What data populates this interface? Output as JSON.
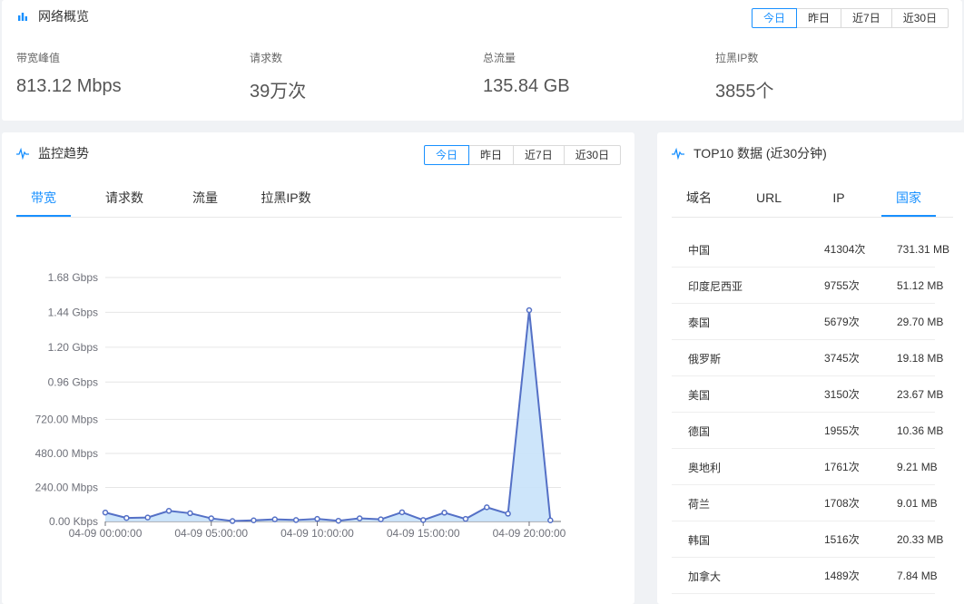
{
  "overview": {
    "title": "网络概览",
    "ranges": [
      "今日",
      "昨日",
      "近7日",
      "近30日"
    ],
    "stats": [
      {
        "label": "带宽峰值",
        "value": "813.12 Mbps"
      },
      {
        "label": "请求数",
        "value": "39万次"
      },
      {
        "label": "总流量",
        "value": "135.84 GB"
      },
      {
        "label": "拉黑IP数",
        "value": "3855个"
      }
    ]
  },
  "trend": {
    "title": "监控趋势",
    "ranges": [
      "今日",
      "昨日",
      "近7日",
      "近30日"
    ],
    "tabs": [
      "带宽",
      "请求数",
      "流量",
      "拉黑IP数"
    ]
  },
  "chart_data": {
    "type": "area",
    "title": "",
    "xlabel": "",
    "ylabel": "",
    "y_unit": "Mbps",
    "ylim": [
      0,
      1720.32
    ],
    "y_ticks": [
      0,
      240,
      480,
      720,
      983.04,
      1228.8,
      1474.56,
      1720.32
    ],
    "y_tick_labels": [
      "0.00 Kbps",
      "240.00 Mbps",
      "480.00 Mbps",
      "720.00 Mbps",
      "0.96 Gbps",
      "1.20 Gbps",
      "1.44 Gbps",
      "1.68 Gbps"
    ],
    "x_tick_labels": [
      "04-09 00:00:00",
      "04-09 05:00:00",
      "04-09 10:00:00",
      "04-09 15:00:00",
      "04-09 20:00:00"
    ],
    "x_hours": [
      0,
      1,
      2,
      3,
      4,
      5,
      6,
      7,
      8,
      9,
      10,
      11,
      12,
      13,
      14,
      15,
      16,
      17,
      18,
      19,
      20,
      21
    ],
    "series": [
      {
        "values": [
          63,
          25,
          28,
          75,
          58,
          22,
          3,
          8,
          15,
          10,
          18,
          5,
          22,
          15,
          65,
          10,
          62,
          18,
          100,
          55,
          1490,
          8
        ]
      }
    ],
    "grid": true,
    "color": "#5470c6"
  },
  "top10": {
    "title": "TOP10 数据 (近30分钟)",
    "tabs": [
      "域名",
      "URL",
      "IP",
      "国家"
    ],
    "rows": [
      {
        "name": "中国",
        "requests": "41304次",
        "traffic": "731.31 MB"
      },
      {
        "name": "印度尼西亚",
        "requests": "9755次",
        "traffic": "51.12 MB"
      },
      {
        "name": "泰国",
        "requests": "5679次",
        "traffic": "29.70 MB"
      },
      {
        "name": "俄罗斯",
        "requests": "3745次",
        "traffic": "19.18 MB"
      },
      {
        "name": "美国",
        "requests": "3150次",
        "traffic": "23.67 MB"
      },
      {
        "name": "德国",
        "requests": "1955次",
        "traffic": "10.36 MB"
      },
      {
        "name": "奥地利",
        "requests": "1761次",
        "traffic": "9.21 MB"
      },
      {
        "name": "荷兰",
        "requests": "1708次",
        "traffic": "9.01 MB"
      },
      {
        "name": "韩国",
        "requests": "1516次",
        "traffic": "20.33 MB"
      },
      {
        "name": "加拿大",
        "requests": "1489次",
        "traffic": "7.84 MB"
      }
    ]
  }
}
